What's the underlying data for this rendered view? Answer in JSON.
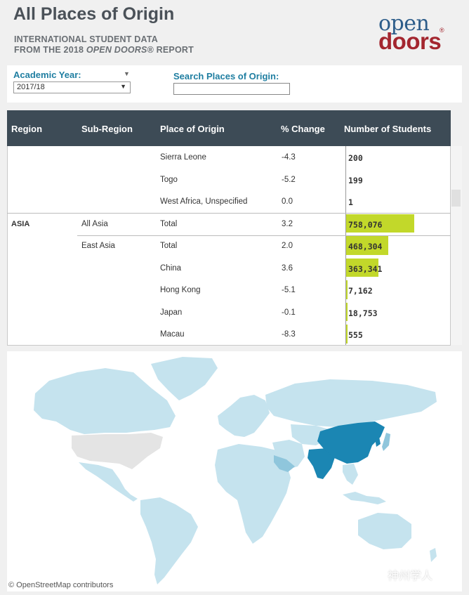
{
  "header": {
    "title": "All Places of Origin",
    "subtitle_line1": "INTERNATIONAL STUDENT DATA",
    "subtitle_line2_prefix": "FROM THE 2018 ",
    "subtitle_line2_italic": "OPEN DOORS",
    "subtitle_line2_suffix": "® REPORT",
    "logo_open": "open",
    "logo_doors": "doors",
    "logo_reg": "®"
  },
  "filters": {
    "year_label": "Academic Year:",
    "year_value": "2017/18",
    "search_label": "Search Places of Origin:",
    "search_value": ""
  },
  "table": {
    "headers": [
      "Region",
      "Sub-Region",
      "Place of Origin",
      "% Change",
      "Number of Students"
    ],
    "rows": [
      {
        "region": "",
        "subregion": "",
        "place": "Sierra Leone",
        "change": "-4.3",
        "students": "200",
        "bar": 0
      },
      {
        "region": "",
        "subregion": "",
        "place": "Togo",
        "change": "-5.2",
        "students": "199",
        "bar": 0
      },
      {
        "region": "",
        "subregion": "",
        "place": "West Africa, Unspecified",
        "change": "0.0",
        "students": "1",
        "bar": 0
      },
      {
        "region": "ASIA",
        "subregion": "All Asia",
        "place": "Total",
        "change": "3.2",
        "students": "758,076",
        "bar": 1.0
      },
      {
        "region": "",
        "subregion": "East Asia",
        "place": "Total",
        "change": "2.0",
        "students": "468,304",
        "bar": 0.618
      },
      {
        "region": "",
        "subregion": "",
        "place": "China",
        "change": "3.6",
        "students": "363,341",
        "bar": 0.479
      },
      {
        "region": "",
        "subregion": "",
        "place": "Hong Kong",
        "change": "-5.1",
        "students": "7,162",
        "bar": 0.009
      },
      {
        "region": "",
        "subregion": "",
        "place": "Japan",
        "change": "-0.1",
        "students": "18,753",
        "bar": 0.025
      },
      {
        "region": "",
        "subregion": "",
        "place": "Macau",
        "change": "-8.3",
        "students": "555",
        "bar": 0.001
      }
    ]
  },
  "map": {
    "credit": "© OpenStreetMap contributors",
    "watermark": "神州学人",
    "colors": {
      "ocean": "#ffffff",
      "land": "#c5e3ee",
      "mid": "#8fc6dc",
      "highlight": "#1b86b3",
      "no_data": "#e4e4e4"
    }
  },
  "colors": {
    "accent": "#1f7ea1",
    "header_bg": "#3d4b56",
    "bar": "#c2d82a",
    "brand_red": "#a3262f",
    "brand_blue": "#2d5d8a"
  }
}
